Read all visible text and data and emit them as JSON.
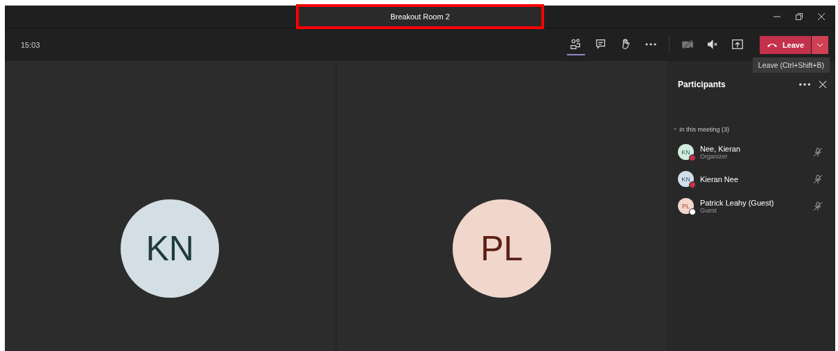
{
  "window": {
    "title": "Breakout Room 2",
    "highlighted": true
  },
  "toolbar": {
    "timer": "15:03",
    "buttons": [
      {
        "kind": "people",
        "selected": true
      },
      {
        "kind": "chat",
        "selected": false
      },
      {
        "kind": "hand",
        "selected": false
      },
      {
        "kind": "more",
        "selected": false
      },
      {
        "kind": "camera-off",
        "selected": false
      },
      {
        "kind": "speaker-mute",
        "selected": false
      },
      {
        "kind": "share",
        "selected": false
      }
    ],
    "leave": {
      "label": "Leave",
      "tooltip": "Leave (Ctrl+Shift+B)"
    }
  },
  "tiles": [
    {
      "initials": "KN"
    },
    {
      "initials": "PL"
    }
  ],
  "participants": {
    "title": "Participants",
    "section": "In this meeting (3)",
    "people": [
      {
        "initials": "KN",
        "name": "Nee, Kieran",
        "role": "Organizer",
        "color": "#c4314b"
      },
      {
        "initials": "KN",
        "name": "Kieran Nee",
        "color": "#c4314b"
      },
      {
        "initials": "PL",
        "name": "Patrick Leahy (Guest)",
        "role": "Guest",
        "color": "#ffffff"
      }
    ]
  }
}
